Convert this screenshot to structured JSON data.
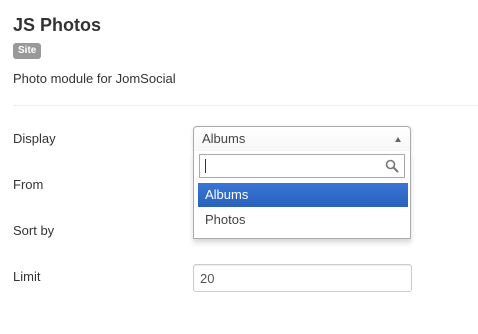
{
  "module": {
    "title": "JS Photos",
    "badge": "Site",
    "description": "Photo module for JomSocial"
  },
  "fields": {
    "display": {
      "label": "Display",
      "selected": "Albums",
      "search_value": "",
      "options": [
        "Albums",
        "Photos"
      ],
      "highlighted_option": "Albums"
    },
    "from": {
      "label": "From"
    },
    "sort_by": {
      "label": "Sort by"
    },
    "limit": {
      "label": "Limit",
      "value": "20"
    }
  },
  "colors": {
    "badge": "#999999",
    "highlight": "#3875d7",
    "text": "#333333"
  },
  "icons": {
    "search": "search-icon",
    "dropdown_arrow": "chevron-up-icon"
  }
}
